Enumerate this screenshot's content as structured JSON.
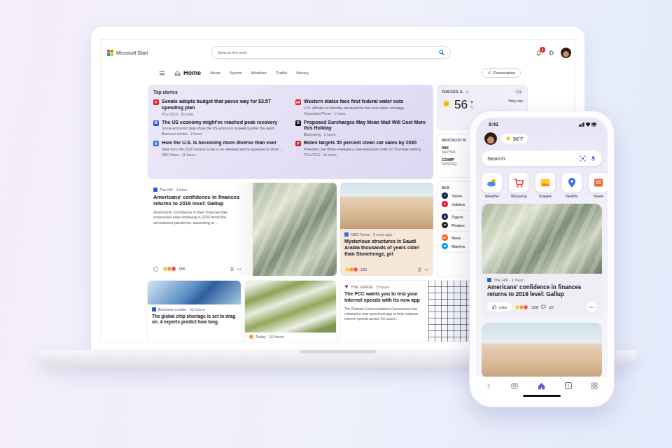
{
  "laptop": {
    "logo": "Microsoft Start",
    "search_placeholder": "Search the web",
    "notification_count": "1",
    "nav": [
      {
        "label": "Home",
        "selected": true
      },
      {
        "label": "News",
        "selected": false
      },
      {
        "label": "Sports",
        "selected": false
      },
      {
        "label": "Weather",
        "selected": false
      },
      {
        "label": "Traffic",
        "selected": false
      },
      {
        "label": "Money",
        "selected": false
      }
    ],
    "personalize": "Personalize",
    "top_stories": {
      "title": "Top stories",
      "items": [
        {
          "badge": "P",
          "color": "#d8232a",
          "title": "Senate adopts budget that paves way for $3.5T spending plan",
          "source": "POLITICO · 51 mins"
        },
        {
          "badge": "BI",
          "color": "#1d5fd6",
          "title": "The US economy might've reached peak recovery",
          "desc": "Some economic data show the US economy is peaking after the rapid...",
          "source": "Business Insider · 2 hours"
        },
        {
          "badge": "N",
          "color": "#3c6fd8",
          "title": "How the U.S. is becoming more diverse than ever",
          "desc": "Data from the 2020 census is set to be released and is expected to show ...",
          "source": "NBC News · 11 hours"
        },
        {
          "badge": "AP",
          "color": "#e0242b",
          "title": "Western states face first federal water cuts",
          "desc": "U.S. officials on Monday declared the first ever water shortage...",
          "source": "Associated Press · 1 hours"
        },
        {
          "badge": "B",
          "color": "#111111",
          "title": "Proposed Surcharges May Mean Mail Will Cost More this Holiday",
          "source": "Bloomberg · 1 hours"
        },
        {
          "badge": "P",
          "color": "#d8232a",
          "title": "Biden targets 50 percent clean car sales by 2030",
          "desc": "President Joe Biden released a new executive order on Thursday setting...",
          "source": "POLITICO · 11 hours"
        }
      ]
    },
    "weather": {
      "location": "CHICAGO, IL",
      "temperature": "56",
      "unit_primary": "°F",
      "unit_secondary": "°C",
      "condition": "Hazy day"
    },
    "watchlist": {
      "title": "WATCHLIST M",
      "items": [
        {
          "symbol": "INX",
          "name": "S&P 500"
        },
        {
          "symbol": "COMP",
          "name": "NASDAQ"
        }
      ]
    },
    "mlb": {
      "title": "MLB",
      "games": [
        {
          "teams": [
            {
              "name": "Twins",
              "badge": "T",
              "color": "#0c2340"
            },
            {
              "name": "Indians",
              "badge": "C",
              "color": "#e31937"
            }
          ]
        },
        {
          "teams": [
            {
              "name": "Tigers",
              "badge": "D",
              "color": "#0c2340"
            },
            {
              "name": "Pirates",
              "badge": "P",
              "color": "#27251f"
            }
          ]
        },
        {
          "teams": [
            {
              "name": "Mets",
              "badge": "NY",
              "color": "#ff5910"
            },
            {
              "name": "Marlins",
              "badge": "M",
              "color": "#00a3e0"
            }
          ]
        }
      ]
    },
    "cards_top": [
      {
        "kind": "wide",
        "color": "#1d5fd6",
        "source": "The Hill · 1 hour",
        "title": "Americans' confidence in finances returns to 2019 level: Gallup",
        "desc": "Americans' confidence in their finances has rebounded after dropping in 2020 amid the coronavirus pandemic, according to ...",
        "reactions": "158"
      },
      {
        "kind": "tall",
        "color": "#3c6fd8",
        "source": "NBC News · 3 mins ago",
        "title": "Mysterious structures in Saudi Arabia thousands of years older than Stonehenge, pri",
        "reactions": "192"
      }
    ],
    "cards_bottom": [
      {
        "kind": "overlay",
        "color": "#1d5fd6",
        "source": "Business Insider · 11 hours",
        "title": "The global chip shortage is set to drag on. 4 experts predict how long"
      },
      {
        "kind": "image",
        "color": "#f0a030",
        "source": "Today · 10 hours"
      },
      {
        "kind": "split",
        "color": "#5a2d91",
        "source": "THE VERGE · 5 hours",
        "title": "The FCC wants you to test your internet speeds with its new app",
        "desc": "The Federal Communications Commission has released a new speed test app to help measure internet speeds across the count..."
      }
    ]
  },
  "phone": {
    "time": "9:41",
    "temperature": "56°F",
    "search_placeholder": "Search",
    "apps": [
      {
        "label": "Weather",
        "kind": "weather"
      },
      {
        "label": "Shopping",
        "kind": "shopping"
      },
      {
        "label": "Images",
        "kind": "images"
      },
      {
        "label": "Nearby",
        "kind": "nearby"
      },
      {
        "label": "News",
        "kind": "news"
      }
    ],
    "card": {
      "color": "#1d5fd6",
      "source": "The Hill · 1 hour",
      "title": "Americans' confidence in finances returns to 2019 level: Gallup",
      "like": "Like",
      "reactions": "158",
      "comments": "20"
    },
    "bottom_nav": [
      {
        "kind": "back",
        "selected": false
      },
      {
        "kind": "feed",
        "selected": false
      },
      {
        "kind": "home",
        "selected": true
      },
      {
        "kind": "tabs",
        "label": "1",
        "selected": false
      },
      {
        "kind": "apps",
        "selected": false
      }
    ]
  }
}
